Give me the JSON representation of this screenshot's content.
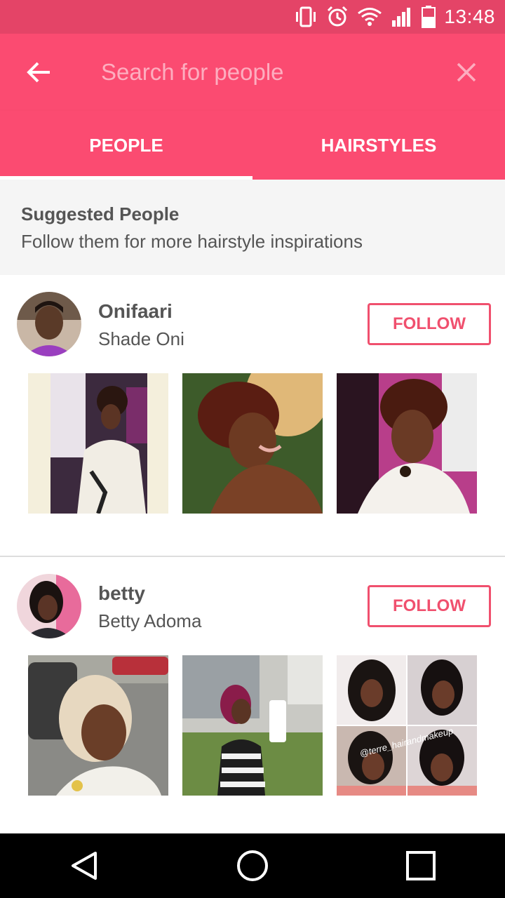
{
  "status_bar": {
    "time": "13:48",
    "icons": [
      "vibrate-icon",
      "alarm-icon",
      "wifi-icon",
      "signal-icon",
      "battery-icon"
    ]
  },
  "search": {
    "placeholder": "Search for people"
  },
  "tabs": [
    {
      "label": "PEOPLE",
      "active": true
    },
    {
      "label": "HAIRSTYLES",
      "active": false
    }
  ],
  "suggested": {
    "title": "Suggested People",
    "subtitle": "Follow them for more hairstyle inspirations"
  },
  "people": [
    {
      "username": "Onifaari",
      "full_name": "Shade Oni",
      "follow_label": "FOLLOW",
      "photo_count": 3
    },
    {
      "username": "betty",
      "full_name": "Betty Adoma",
      "follow_label": "FOLLOW",
      "photo_count": 3
    }
  ],
  "photo_overlay_text": "@terre_hairandmakeup",
  "colors": {
    "status_bar": "#e44467",
    "primary": "#fb4b71",
    "follow_accent": "#f0506e",
    "text": "#555555",
    "section_bg": "#f5f5f5"
  }
}
